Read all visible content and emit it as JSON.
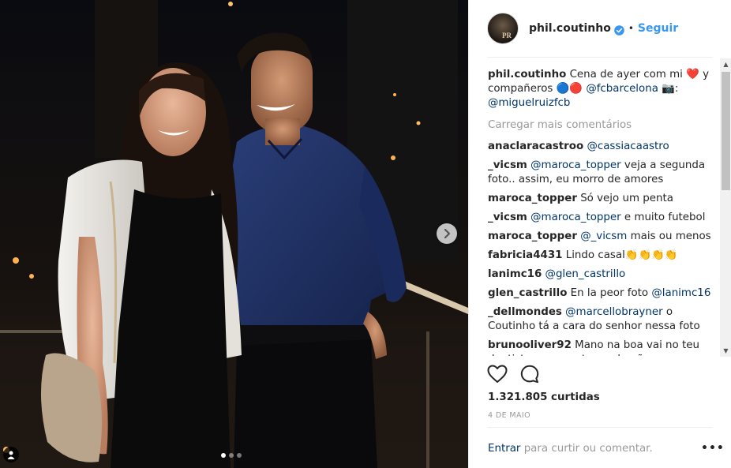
{
  "header": {
    "username": "phil.coutinho",
    "avatar_letters": "PR",
    "separator": "•",
    "follow_label": "Seguir"
  },
  "caption": {
    "username": "phil.coutinho",
    "text_before": "Cena de ayer com mi",
    "heart": "❤️",
    "text_middle": "y compañeros",
    "circle_blue": "🔵",
    "circle_red": "🔴",
    "mention_club": "@fcbarcelona",
    "camera": "📷",
    "colon": ":",
    "mention_photographer": "@miguelruizfcb"
  },
  "load_more_label": "Carregar mais comentários",
  "comments": [
    {
      "user": "anaclaracastroo",
      "mention": "@cassiacaastro",
      "text": ""
    },
    {
      "user": "_vicsm",
      "mention": "@maroca_topper",
      "text": "veja a segunda foto.. assim, eu morro de amores"
    },
    {
      "user": "maroca_topper",
      "mention": "",
      "text": "Só vejo um penta"
    },
    {
      "user": "_vicsm",
      "mention": "@maroca_topper",
      "text": "e muito futebol"
    },
    {
      "user": "maroca_topper",
      "mention": "@_vicsm",
      "text": "mais ou menos"
    },
    {
      "user": "fabricia4431",
      "mention": "",
      "text": "Lindo casal👏👏👏👏"
    },
    {
      "user": "lanimc16",
      "mention": "@glen_castrillo",
      "text": ""
    },
    {
      "user": "glen_castrillo",
      "mention": "",
      "text": "En la peor foto",
      "mention_after": "@lanimc16"
    },
    {
      "user": "_dellmondes",
      "mention": "@marcellobrayner",
      "text": "o Coutinho tá a cara do senhor nessa foto"
    },
    {
      "user": "brunooliver92",
      "mention": "",
      "text": "Mano na boa vai no teu dentista e pergunta se ele não quer ser meu"
    }
  ],
  "likes_text": "1.321.805 curtidas",
  "date_text": "4 DE MAIO",
  "footer": {
    "login_label": "Entrar",
    "prompt": "para curtir ou comentar.",
    "more_label": "•••"
  },
  "icons": {
    "heart": "heart-icon",
    "comment": "comment-icon",
    "next": "chevron-right-icon",
    "verified": "verified-badge-icon",
    "user_tag": "user-tag-icon"
  },
  "colors": {
    "accent": "#3897f0",
    "link": "#003569",
    "muted": "#999999",
    "text": "#262626"
  }
}
